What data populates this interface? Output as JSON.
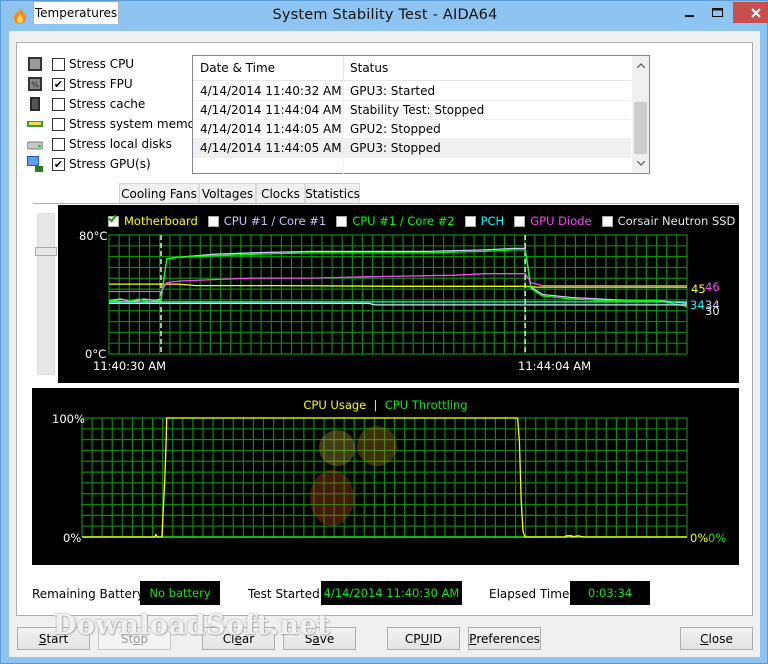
{
  "window": {
    "title": "System Stability Test - AIDA64",
    "controls": {
      "minimize": "—",
      "maximize": "☐",
      "close": "✕"
    }
  },
  "stress_options": [
    {
      "label": "Stress CPU",
      "checked": false,
      "icon": "cpu-chip-icon"
    },
    {
      "label": "Stress FPU",
      "checked": true,
      "icon": "fpu-chip-icon"
    },
    {
      "label": "Stress cache",
      "checked": false,
      "icon": "cache-chip-icon"
    },
    {
      "label": "Stress system memory",
      "checked": false,
      "icon": "memory-module-icon"
    },
    {
      "label": "Stress local disks",
      "checked": false,
      "icon": "hard-disk-icon"
    },
    {
      "label": "Stress GPU(s)",
      "checked": true,
      "icon": "gpu-monitor-icon"
    }
  ],
  "log": {
    "columns": [
      "Date & Time",
      "Status"
    ],
    "rows": [
      {
        "time": "4/14/2014 11:40:32 AM",
        "status": "GPU3: Started"
      },
      {
        "time": "4/14/2014 11:44:04 AM",
        "status": "Stability Test: Stopped"
      },
      {
        "time": "4/14/2014 11:44:05 AM",
        "status": "GPU2: Stopped"
      },
      {
        "time": "4/14/2014 11:44:05 AM",
        "status": "GPU3: Stopped",
        "selected": true
      }
    ],
    "scroll_up": "^",
    "scroll_down": "v"
  },
  "tabs": [
    {
      "label": "Temperatures",
      "active": true
    },
    {
      "label": "Cooling Fans",
      "active": false
    },
    {
      "label": "Voltages",
      "active": false
    },
    {
      "label": "Clocks",
      "active": false
    },
    {
      "label": "Statistics",
      "active": false
    }
  ],
  "check_glyph": "✔",
  "chart_data": [
    {
      "type": "line",
      "title": "Temperatures",
      "ylabel": "°C",
      "ylim": [
        0,
        80
      ],
      "y_tick_labels": [
        "80°C",
        "0°C"
      ],
      "x_tick_labels": [
        "11:40:30 AM",
        "11:44:04 AM"
      ],
      "x_range": [
        0,
        100
      ],
      "markers": [
        9,
        72
      ],
      "grid": true,
      "legend_position": "top",
      "series": [
        {
          "name": "Motherboard",
          "color": "#ffff00",
          "current": 45,
          "points": [
            [
              0,
              47
            ],
            [
              9,
              47
            ],
            [
              10,
              47
            ],
            [
              12,
              47
            ],
            [
              15,
              46
            ],
            [
              28,
              46
            ],
            [
              50,
              45.5
            ],
            [
              72,
              45.5
            ],
            [
              74,
              45
            ],
            [
              100,
              45
            ]
          ]
        },
        {
          "name": "CPU #1 / Core #1",
          "color": "#c8c8ff",
          "current": 34,
          "points": [
            [
              0,
              36
            ],
            [
              2,
              37
            ],
            [
              4,
              35
            ],
            [
              6,
              37
            ],
            [
              8,
              36
            ],
            [
              9,
              37
            ],
            [
              10,
              64
            ],
            [
              12,
              65
            ],
            [
              18,
              67
            ],
            [
              25,
              68
            ],
            [
              35,
              69
            ],
            [
              45,
              69
            ],
            [
              55,
              69
            ],
            [
              65,
              70
            ],
            [
              70,
              71
            ],
            [
              72,
              71
            ],
            [
              73,
              45
            ],
            [
              75,
              40
            ],
            [
              80,
              38
            ],
            [
              85,
              37
            ],
            [
              90,
              36
            ],
            [
              95,
              36
            ],
            [
              100,
              34
            ]
          ]
        },
        {
          "name": "CPU #1 / Core #2",
          "color": "#00ff00",
          "current": 34,
          "points": [
            [
              0,
              36
            ],
            [
              3,
              35
            ],
            [
              5,
              37
            ],
            [
              7,
              35
            ],
            [
              9,
              36
            ],
            [
              10,
              64
            ],
            [
              12,
              65
            ],
            [
              18,
              66
            ],
            [
              25,
              67
            ],
            [
              35,
              68
            ],
            [
              45,
              68
            ],
            [
              55,
              68
            ],
            [
              65,
              69
            ],
            [
              70,
              70
            ],
            [
              72,
              70
            ],
            [
              73,
              44
            ],
            [
              75,
              39
            ],
            [
              80,
              37
            ],
            [
              85,
              36
            ],
            [
              90,
              36
            ],
            [
              95,
              36
            ],
            [
              100,
              32
            ]
          ]
        },
        {
          "name": "PCH",
          "color": "#00ffff",
          "current": 34,
          "points": [
            [
              0,
              35
            ],
            [
              100,
              35
            ]
          ]
        },
        {
          "name": "GPU Diode",
          "color": "#ff44ff",
          "current": 46,
          "points": [
            [
              0,
              42
            ],
            [
              9,
              42
            ],
            [
              10,
              48
            ],
            [
              12,
              49
            ],
            [
              18,
              50
            ],
            [
              25,
              51
            ],
            [
              35,
              51
            ],
            [
              45,
              52
            ],
            [
              60,
              53
            ],
            [
              65,
              54
            ],
            [
              72,
              54
            ],
            [
              73,
              48
            ],
            [
              75,
              46
            ],
            [
              80,
              46
            ],
            [
              90,
              46
            ],
            [
              100,
              46
            ]
          ]
        },
        {
          "name": "Corsair Neutron SSD",
          "color": "#e6e6e6",
          "current": 30,
          "points": [
            [
              0,
              34
            ],
            [
              45,
              34
            ],
            [
              46,
              33
            ],
            [
              100,
              33
            ]
          ]
        }
      ]
    },
    {
      "type": "line",
      "title": "CPU Usage | CPU Throttling",
      "ylim": [
        0,
        100
      ],
      "y_tick_labels": [
        "100%",
        "0%"
      ],
      "x_range": [
        0,
        100
      ],
      "grid": true,
      "legend_position": "top",
      "series": [
        {
          "name": "CPU Usage",
          "color": "#ffff00",
          "current": "0%",
          "points": [
            [
              0,
              0
            ],
            [
              12,
              0
            ],
            [
              12.2,
              2
            ],
            [
              12.5,
              0
            ],
            [
              13,
              0
            ],
            [
              13.2,
              0
            ],
            [
              13.3,
              10
            ],
            [
              13.5,
              30
            ],
            [
              13.7,
              50
            ],
            [
              13.9,
              80
            ],
            [
              14,
              100
            ],
            [
              72,
              100
            ],
            [
              72.3,
              80
            ],
            [
              72.6,
              30
            ],
            [
              72.9,
              5
            ],
            [
              73.2,
              0
            ],
            [
              80,
              0
            ],
            [
              80,
              1
            ],
            [
              81,
              1
            ],
            [
              81,
              0
            ],
            [
              82,
              1
            ],
            [
              83,
              0
            ],
            [
              100,
              0
            ]
          ]
        },
        {
          "name": "CPU Throttling",
          "color": "#00ff00",
          "current": "0%",
          "points": [
            [
              0,
              0
            ],
            [
              100,
              0
            ]
          ]
        }
      ]
    }
  ],
  "status": {
    "battery_label": "Remaining Battery:",
    "battery_value": "No battery",
    "started_label": "Test Started:",
    "started_value": "4/14/2014 11:40:30 AM",
    "elapsed_label": "Elapsed Time:",
    "elapsed_value": "0:03:34"
  },
  "watermark": "DownloadSoft.net",
  "buttons": {
    "start": {
      "pre": "",
      "u": "S",
      "post": "tart"
    },
    "stop": {
      "pre": "St",
      "u": "o",
      "post": "p"
    },
    "clear": {
      "pre": "Cl",
      "u": "e",
      "post": "ar"
    },
    "save": {
      "pre": "S",
      "u": "a",
      "post": "ve"
    },
    "cpuid": {
      "pre": "CP",
      "u": "U",
      "post": "ID"
    },
    "preferences": {
      "pre": "",
      "u": "P",
      "post": "references"
    },
    "close": {
      "pre": "",
      "u": "C",
      "post": "lose"
    }
  }
}
